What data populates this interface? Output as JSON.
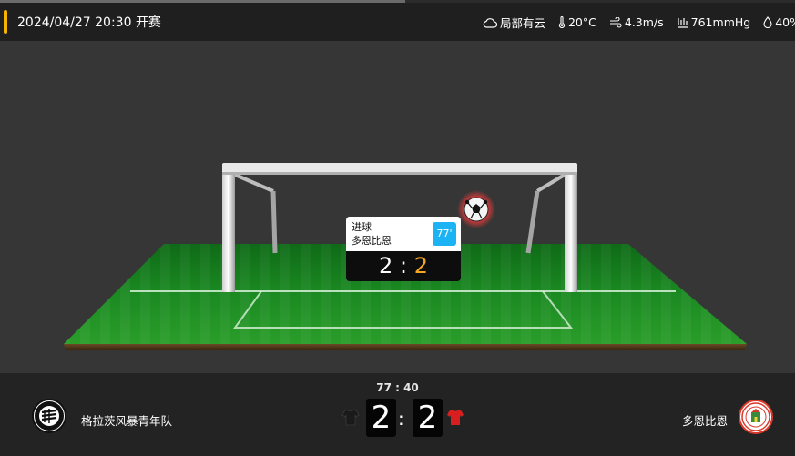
{
  "header": {
    "kickoff": "2024/04/27 20:30 开赛",
    "accent_color": "#f5b400"
  },
  "weather": {
    "condition": "局部有云",
    "temperature": "20°C",
    "wind": "4.3m/s",
    "pressure": "761mmHg",
    "humidity": "40%",
    "icons": [
      "cloud-icon",
      "thermometer-icon",
      "wind-icon",
      "pressure-icon",
      "humidity-icon"
    ]
  },
  "event": {
    "type": "进球",
    "team": "多恩比恩",
    "minute": "77'",
    "score_home": "2",
    "score_sep": ":",
    "score_away": "2",
    "minute_color": "#1cb3f5",
    "highlight_color": "#f5a623"
  },
  "match": {
    "clock": "77 : 40",
    "home_team": "格拉茨风暴青年队",
    "away_team": "多恩比恩",
    "home_score": "2",
    "away_score": "2",
    "home_jersey_color": "#1a1a1a",
    "away_jersey_color": "#d81e1e"
  }
}
